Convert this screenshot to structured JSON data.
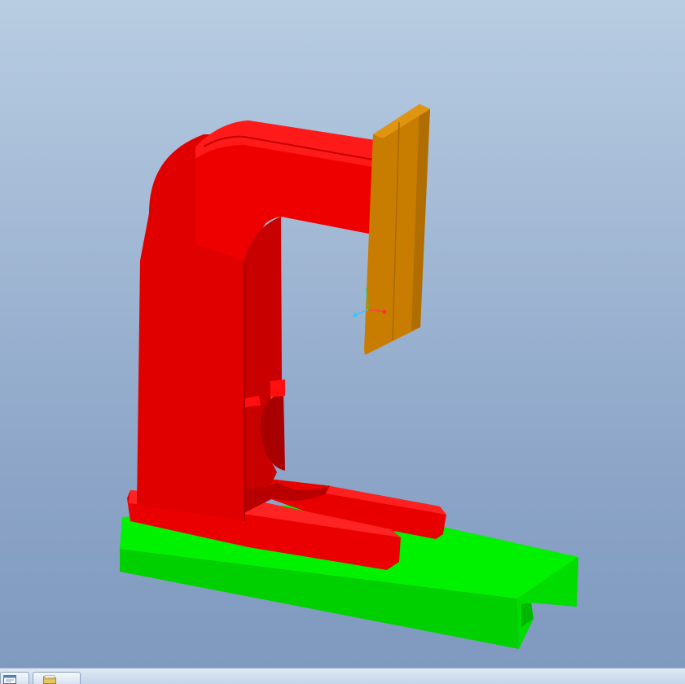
{
  "viewport": {
    "background_top": "#b8cde2",
    "background_bottom": "#7f99bf"
  },
  "model": {
    "frame_color": "#ff0000",
    "base_color": "#00e000",
    "plate_color": "#c88200"
  },
  "taskbar": {
    "items": [
      {
        "icon": "window-icon"
      },
      {
        "icon": "folder-icon"
      }
    ]
  }
}
